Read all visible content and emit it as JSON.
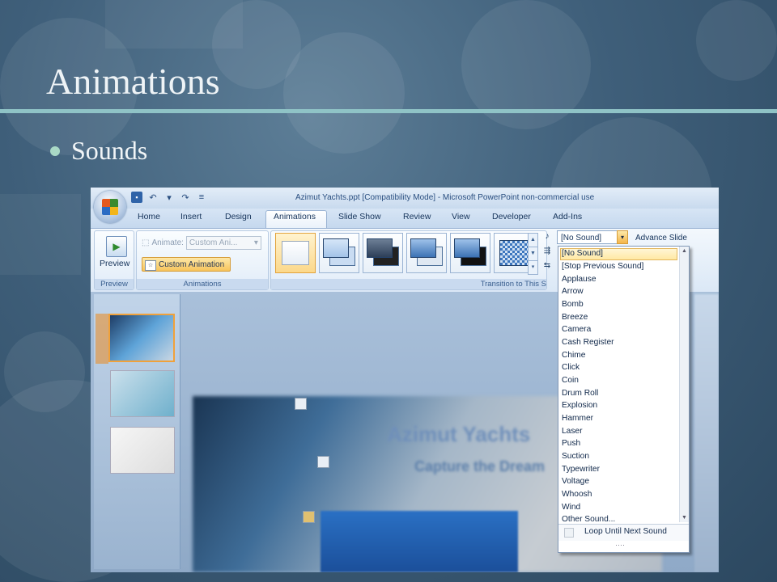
{
  "slide": {
    "title": "Animations",
    "bullet": "Sounds"
  },
  "app": {
    "window_title": "Azimut Yachts.ppt [Compatibility Mode] - Microsoft PowerPoint non-commercial use",
    "tabs": [
      "Home",
      "Insert",
      "Design",
      "Animations",
      "Slide Show",
      "Review",
      "View",
      "Developer",
      "Add-Ins"
    ],
    "active_tab": "Animations"
  },
  "ribbon": {
    "preview_label": "Preview",
    "preview_group": "Preview",
    "animate_label": "Animate:",
    "animate_value": "Custom Ani...",
    "custom_animation_label": "Custom Animation",
    "animations_group": "Animations",
    "transition_group": "Transition to This S",
    "sound_value": "[No Sound]",
    "advance_slide_label": "Advance Slide"
  },
  "sound_menu": {
    "items": [
      "[No Sound]",
      "[Stop Previous Sound]",
      "Applause",
      "Arrow",
      "Bomb",
      "Breeze",
      "Camera",
      "Cash Register",
      "Chime",
      "Click",
      "Coin",
      "Drum Roll",
      "Explosion",
      "Hammer",
      "Laser",
      "Push",
      "Suction",
      "Typewriter",
      "Voltage",
      "Whoosh",
      "Wind",
      "Other Sound..."
    ],
    "selected": "[No Sound]",
    "loop_label": "Loop Until Next Sound"
  },
  "canvas": {
    "title": "Azimut Yachts",
    "subtitle": "Capture the Dream"
  },
  "colors": {
    "title_rule": "#8fc3c6",
    "bullet": "#a9d9c6",
    "highlight": "#ffe9a3"
  }
}
